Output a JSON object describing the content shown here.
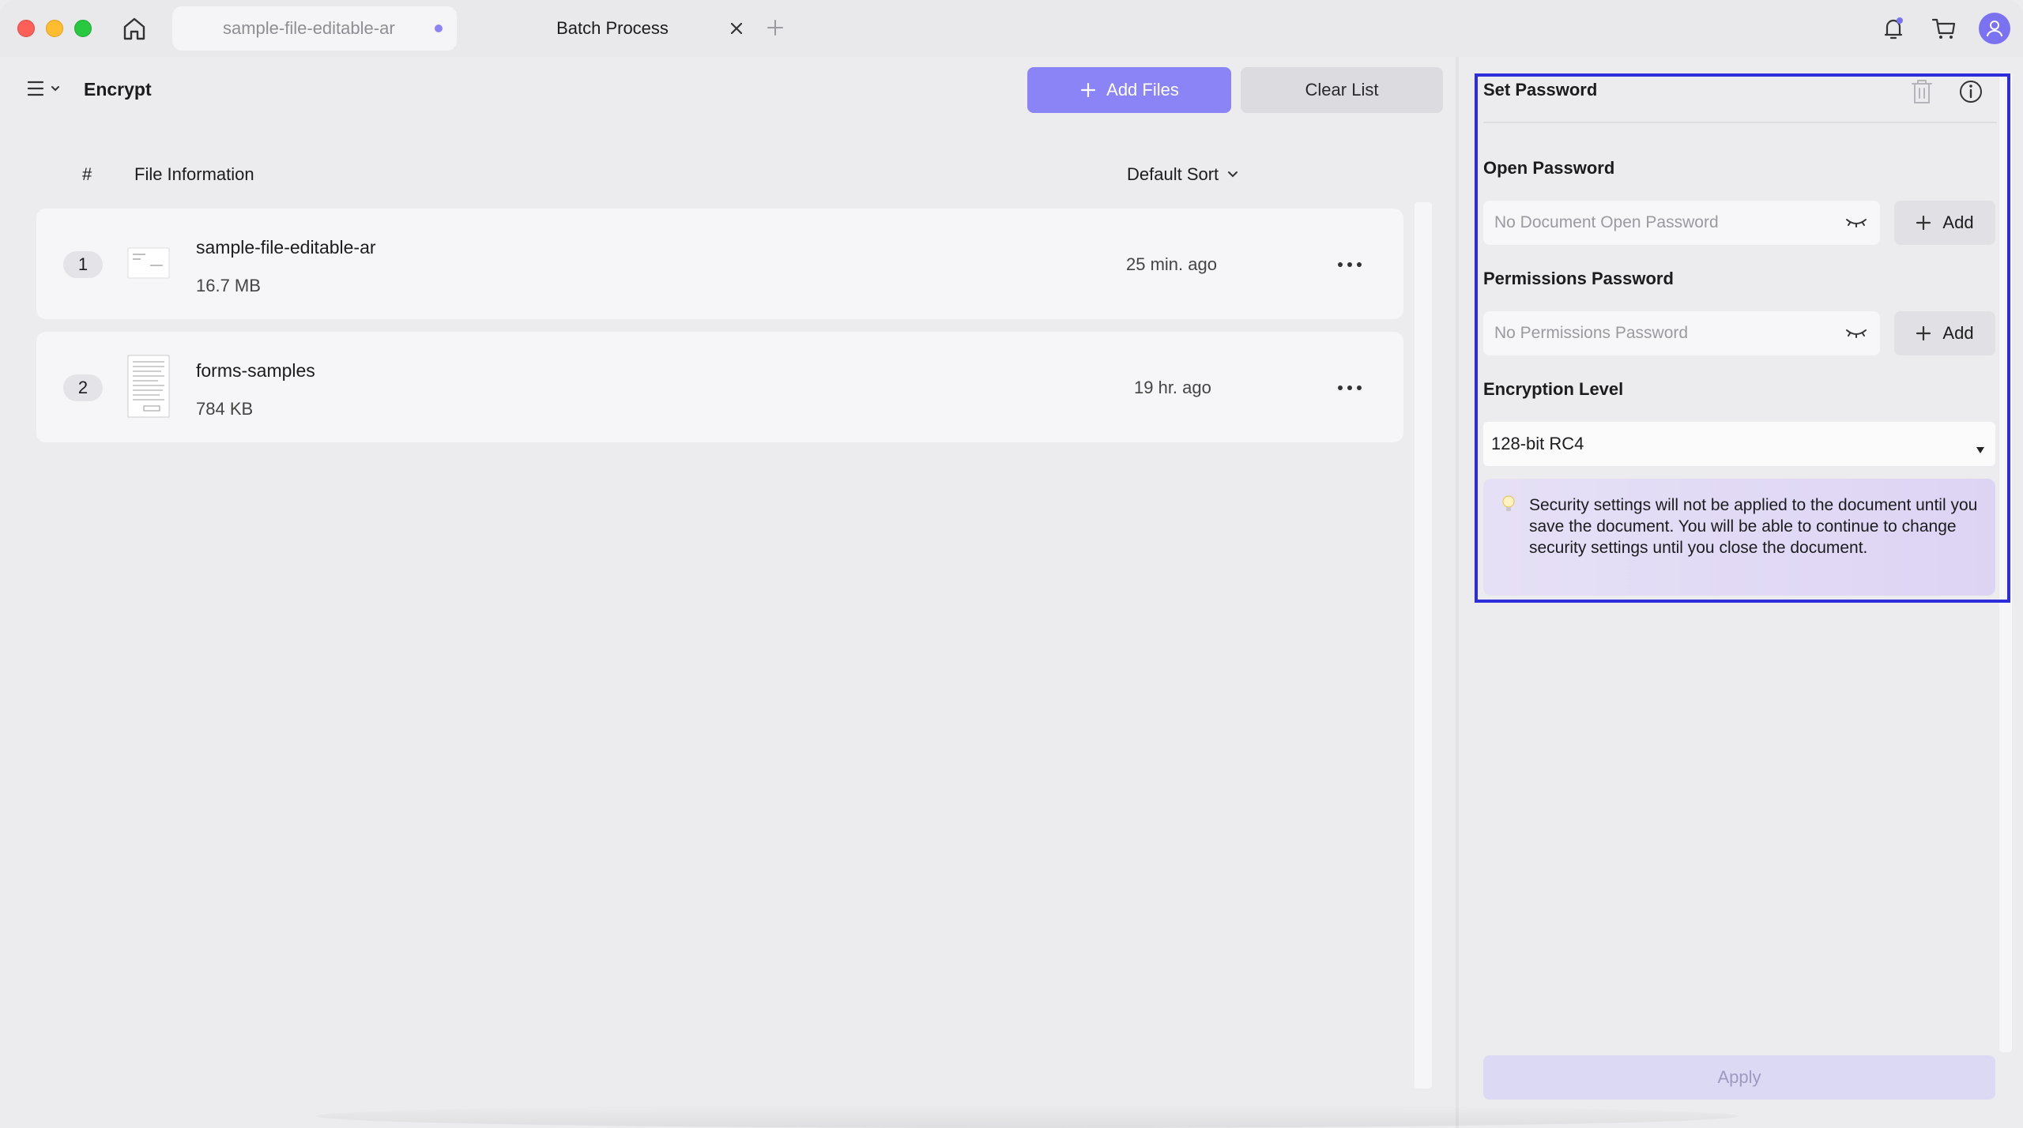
{
  "titlebar": {
    "tabs": [
      {
        "label": "sample-file-editable-ar",
        "unsaved": true
      },
      {
        "label": "Batch Process",
        "active": true
      }
    ]
  },
  "toolbar": {
    "title": "Encrypt",
    "add_files_label": "Add Files",
    "clear_list_label": "Clear List"
  },
  "file_list": {
    "columns": {
      "number": "#",
      "info": "File Information"
    },
    "sort_label": "Default Sort",
    "files": [
      {
        "index": "1",
        "name": "sample-file-editable-ar",
        "size": "16.7 MB",
        "time": "25 min. ago"
      },
      {
        "index": "2",
        "name": "forms-samples",
        "size": "784 KB",
        "time": "19 hr. ago"
      }
    ]
  },
  "settings": {
    "title": "Set Password",
    "open_password": {
      "label": "Open Password",
      "placeholder": "No Document Open Password",
      "add_label": "Add"
    },
    "permissions_password": {
      "label": "Permissions Password",
      "placeholder": "No Permissions Password",
      "add_label": "Add"
    },
    "encryption": {
      "label": "Encryption Level",
      "value": "128-bit RC4"
    },
    "notice": "Security settings will not be applied to the document until you save the document. You will be able to continue to change security settings until you close the document.",
    "apply_label": "Apply"
  },
  "colors": {
    "accent": "#8a84f7",
    "highlight_border": "#2d2dd9",
    "notice_bg": "#e2dbf5",
    "apply_disabled": "#dcd9f5"
  }
}
